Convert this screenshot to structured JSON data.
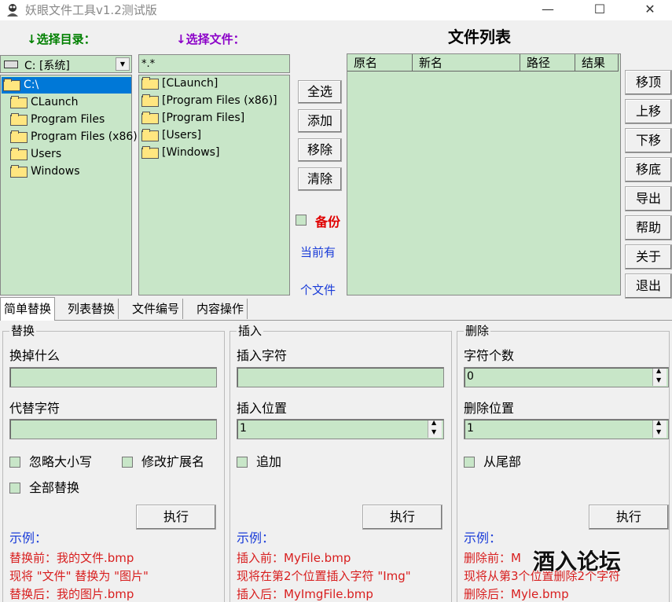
{
  "window": {
    "title": "妖眼文件工具v1.2测试版"
  },
  "labels": {
    "select_dir": "↓选择目录：",
    "select_file": "↓选择文件：",
    "file_list": "文件列表"
  },
  "drive": {
    "value": "C: [系统]"
  },
  "dir_tree": [
    {
      "label": "C:\\",
      "selected": true
    },
    {
      "label": "CLaunch"
    },
    {
      "label": "Program Files"
    },
    {
      "label": "Program Files (x86)"
    },
    {
      "label": "Users"
    },
    {
      "label": "Windows"
    }
  ],
  "file_filter": {
    "value": "*.*"
  },
  "file_entries": [
    "[CLaunch]",
    "[Program Files (x86)]",
    "[Program Files]",
    "[Users]",
    "[Windows]"
  ],
  "mid_buttons": {
    "select_all": "全选",
    "add": "添加",
    "remove": "移除",
    "clear": "清除"
  },
  "backup": {
    "label": "备份",
    "checked": false
  },
  "status": {
    "current_prefix": "当前有",
    "count_suffix": "个文件"
  },
  "table": {
    "columns": [
      "原名",
      "新名",
      "路径",
      "结果"
    ]
  },
  "right_buttons": [
    "移顶",
    "上移",
    "下移",
    "移底",
    "导出",
    "帮助",
    "关于",
    "退出"
  ],
  "tabs": [
    "简单替换",
    "列表替换",
    "文件编号",
    "内容操作"
  ],
  "replace": {
    "title": "替换",
    "find_label": "换掉什么",
    "find_value": "",
    "with_label": "代替字符",
    "with_value": "",
    "ignore_case": "忽略大小写",
    "modify_ext": "修改扩展名",
    "replace_all": "全部替换",
    "exec": "执行",
    "example_head": "示例：",
    "ex1": "替换前：我的文件.bmp",
    "ex2": "现将 \"文件\" 替换为 \"图片\"",
    "ex3": "替换后：我的图片.bmp"
  },
  "insert": {
    "title": "插入",
    "chars_label": "插入字符",
    "chars_value": "",
    "pos_label": "插入位置",
    "pos_value": "1",
    "append": "追加",
    "exec": "执行",
    "example_head": "示例：",
    "ex1": "插入前：MyFile.bmp",
    "ex2": "现将在第2个位置插入字符 \"Img\"",
    "ex3": "插入后：MyImgFile.bmp"
  },
  "delete": {
    "title": "删除",
    "count_label": "字符个数",
    "count_value": "0",
    "pos_label": "删除位置",
    "pos_value": "1",
    "from_end": "从尾部",
    "exec": "执行",
    "example_head": "示例：",
    "ex1": "删除前：M",
    "ex2": "现将从第3个位置删除2个字符",
    "ex3": "删除后：Myle.bmp"
  },
  "watermark": "酒入论坛"
}
